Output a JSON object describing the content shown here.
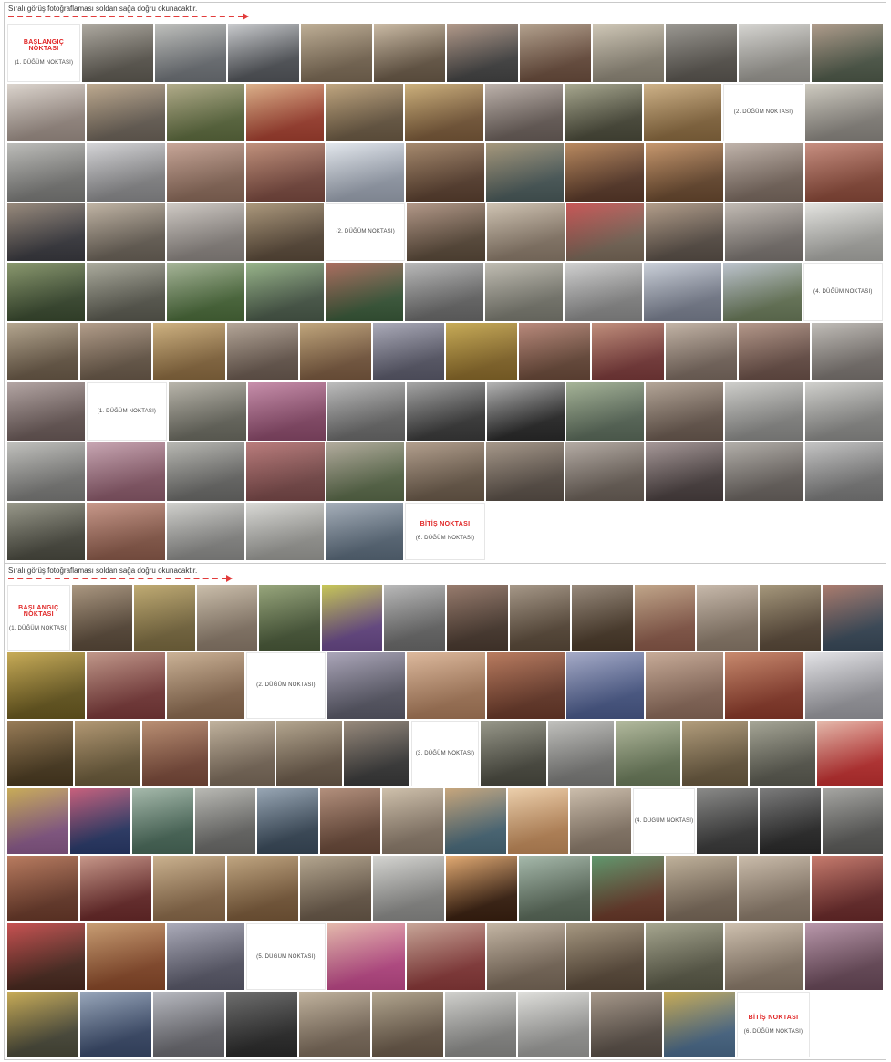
{
  "section1": {
    "heading": "Sıralı görüş fotoğraflaması soldan sağa doğru okunacaktır.",
    "rows": [
      [
        {
          "kind": "label",
          "red": "BAŞLANGIÇ NOKTASI",
          "node": "(1. DÜĞÜM NOKTASI)"
        },
        {
          "kind": "photo",
          "c1": "#5e5a52",
          "c2": "#a39e94"
        },
        {
          "kind": "photo",
          "c1": "#6f7378",
          "c2": "#b7b8b4"
        },
        {
          "kind": "photo",
          "c1": "#53565b",
          "c2": "#c2c4c7"
        },
        {
          "kind": "photo",
          "c1": "#7b6a55",
          "c2": "#b6a488"
        },
        {
          "kind": "photo",
          "c1": "#6a5a48",
          "c2": "#c4b299"
        },
        {
          "kind": "photo",
          "c1": "#444444",
          "c2": "#a88c7a"
        },
        {
          "kind": "photo",
          "c1": "#6b4e3e",
          "c2": "#a9957f"
        },
        {
          "kind": "photo",
          "c1": "#8e8778",
          "c2": "#c9c0ad"
        },
        {
          "kind": "photo",
          "c1": "#5a5650",
          "c2": "#8d8a83"
        },
        {
          "kind": "photo",
          "c1": "#9a9892",
          "c2": "#d0cfcb"
        },
        {
          "kind": "photo",
          "c1": "#4f5a4a",
          "c2": "#a58f7c"
        }
      ],
      [
        {
          "kind": "photo",
          "c1": "#9c8e86",
          "c2": "#d7cfc7"
        },
        {
          "kind": "photo",
          "c1": "#6b6258",
          "c2": "#b59e80"
        },
        {
          "kind": "photo",
          "c1": "#5c6a3e",
          "c2": "#a7a07a"
        },
        {
          "kind": "photo",
          "c1": "#a34030",
          "c2": "#d6a67a"
        },
        {
          "kind": "photo",
          "c1": "#6b5a44",
          "c2": "#b89a6e"
        },
        {
          "kind": "photo",
          "c1": "#7a5a3a",
          "c2": "#c6a66a"
        },
        {
          "kind": "photo",
          "c1": "#6a5f5a",
          "c2": "#b4a8a0"
        },
        {
          "kind": "photo",
          "c1": "#4a4a3a",
          "c2": "#9c9c80"
        },
        {
          "kind": "photo",
          "c1": "#8a6a40",
          "c2": "#c8a878"
        },
        {
          "kind": "label",
          "red": "",
          "node": "(2. DÜĞÜM NOKTASI)"
        },
        {
          "kind": "photo",
          "c1": "#8a8680",
          "c2": "#c8c4b8"
        }
      ],
      [
        {
          "kind": "photo",
          "c1": "#7a7a78",
          "c2": "#b4b4b0"
        },
        {
          "kind": "photo",
          "c1": "#8a8a8c",
          "c2": "#cfcfd2"
        },
        {
          "kind": "photo",
          "c1": "#8a6a5a",
          "c2": "#c09a8a"
        },
        {
          "kind": "photo",
          "c1": "#7a4a40",
          "c2": "#b8826a"
        },
        {
          "kind": "photo",
          "c1": "#9aa2b0",
          "c2": "#dfe4ea"
        },
        {
          "kind": "photo",
          "c1": "#5a4030",
          "c2": "#9a7a5a"
        },
        {
          "kind": "photo",
          "c1": "#4a5a5a",
          "c2": "#9a8a6a"
        },
        {
          "kind": "photo",
          "c1": "#5a3a2a",
          "c2": "#b07a4a"
        },
        {
          "kind": "photo",
          "c1": "#6a4a30",
          "c2": "#c08a5a"
        },
        {
          "kind": "photo",
          "c1": "#7a6a60",
          "c2": "#b8aaa0"
        },
        {
          "kind": "photo",
          "c1": "#8a4a3a",
          "c2": "#c08070"
        }
      ],
      [
        {
          "kind": "photo",
          "c1": "#3a3a40",
          "c2": "#8a7a6a"
        },
        {
          "kind": "photo",
          "c1": "#6a6258",
          "c2": "#b8aa98"
        },
        {
          "kind": "photo",
          "c1": "#8a8480",
          "c2": "#c8c2bc"
        },
        {
          "kind": "photo",
          "c1": "#5a4a3a",
          "c2": "#a08a6a"
        },
        {
          "kind": "label",
          "red": "",
          "node": "(2. DÜĞÜM NOKTASI)"
        },
        {
          "kind": "photo",
          "c1": "#5a4a3a",
          "c2": "#a88a78"
        },
        {
          "kind": "photo",
          "c1": "#8a7a6a",
          "c2": "#c8bba8"
        },
        {
          "kind": "photo",
          "c1": "#7a6a5a",
          "c2": "#c04040"
        },
        {
          "kind": "photo",
          "c1": "#5a5048",
          "c2": "#a8907a"
        },
        {
          "kind": "photo",
          "c1": "#7a7470",
          "c2": "#bab2aa"
        },
        {
          "kind": "photo",
          "c1": "#a8a8a4",
          "c2": "#e0e0dc"
        }
      ],
      [
        {
          "kind": "photo",
          "c1": "#3a4a30",
          "c2": "#7a8a5a"
        },
        {
          "kind": "photo",
          "c1": "#5a5a50",
          "c2": "#a0a090"
        },
        {
          "kind": "photo",
          "c1": "#4a6a3a",
          "c2": "#9aaa8a"
        },
        {
          "kind": "photo",
          "c1": "#4a5a4a",
          "c2": "#8aaa7a"
        },
        {
          "kind": "photo",
          "c1": "#3a5a3a",
          "c2": "#a05a4a"
        },
        {
          "kind": "photo",
          "c1": "#6a6a6a",
          "c2": "#b0b0b0"
        },
        {
          "kind": "photo",
          "c1": "#7a7a70",
          "c2": "#b8b4a8"
        },
        {
          "kind": "photo",
          "c1": "#8a8a8a",
          "c2": "#cacaca"
        },
        {
          "kind": "photo",
          "c1": "#7a8090",
          "c2": "#c4cad4"
        },
        {
          "kind": "photo",
          "c1": "#6a7a5a",
          "c2": "#b4bcc8"
        },
        {
          "kind": "label",
          "red": "",
          "node": "(4. DÜĞÜM NOKTASI)"
        }
      ],
      [
        {
          "kind": "photo",
          "c1": "#6a5a48",
          "c2": "#aa9a80"
        },
        {
          "kind": "photo",
          "c1": "#6a5a4a",
          "c2": "#a8907a"
        },
        {
          "kind": "photo",
          "c1": "#8a6a40",
          "c2": "#c8a870"
        },
        {
          "kind": "photo",
          "c1": "#6a5a50",
          "c2": "#aa9a8a"
        },
        {
          "kind": "photo",
          "c1": "#7a5a40",
          "c2": "#b89a6a"
        },
        {
          "kind": "photo",
          "c1": "#5a5a6a",
          "c2": "#a0a0b0"
        },
        {
          "kind": "photo",
          "c1": "#8a6a2a",
          "c2": "#c0a040"
        },
        {
          "kind": "photo",
          "c1": "#6a4a3a",
          "c2": "#b07a6a"
        },
        {
          "kind": "photo",
          "c1": "#7a3a3a",
          "c2": "#b8806a"
        },
        {
          "kind": "photo",
          "c1": "#7a6a60",
          "c2": "#bbaa9a"
        },
        {
          "kind": "photo",
          "c1": "#6a5048",
          "c2": "#aa8a7a"
        },
        {
          "kind": "photo",
          "c1": "#7a7470",
          "c2": "#b8b4ae"
        }
      ],
      [
        {
          "kind": "photo",
          "c1": "#6a5a58",
          "c2": "#aa9a98"
        },
        {
          "kind": "label",
          "red": "",
          "node": "(1. DÜĞÜM NOKTASI)"
        },
        {
          "kind": "photo",
          "c1": "#6a6a60",
          "c2": "#b0aca0"
        },
        {
          "kind": "photo",
          "c1": "#8a4a6a",
          "c2": "#c080a0"
        },
        {
          "kind": "photo",
          "c1": "#6a6a6a",
          "c2": "#b4b4b4"
        },
        {
          "kind": "photo",
          "c1": "#3a3a3a",
          "c2": "#9a9a9a"
        },
        {
          "kind": "photo",
          "c1": "#2a2a2a",
          "c2": "#aaaaaa"
        },
        {
          "kind": "photo",
          "c1": "#5a6a5a",
          "c2": "#9aaa8a"
        },
        {
          "kind": "photo",
          "c1": "#6a5a50",
          "c2": "#aa9a8a"
        },
        {
          "kind": "photo",
          "c1": "#8a8a88",
          "c2": "#c8c8c4"
        },
        {
          "kind": "photo",
          "c1": "#8a8a88",
          "c2": "#cacac6"
        }
      ],
      [
        {
          "kind": "photo",
          "c1": "#7a7a78",
          "c2": "#b8b8b4"
        },
        {
          "kind": "photo",
          "c1": "#8a5a6a",
          "c2": "#c09aa8"
        },
        {
          "kind": "photo",
          "c1": "#6a6a68",
          "c2": "#aeaea8"
        },
        {
          "kind": "photo",
          "c1": "#7a4a4a",
          "c2": "#b06a6a"
        },
        {
          "kind": "photo",
          "c1": "#5a6a4a",
          "c2": "#a8a090"
        },
        {
          "kind": "photo",
          "c1": "#6a5a4a",
          "c2": "#a8927e"
        },
        {
          "kind": "photo",
          "c1": "#5a5048",
          "c2": "#9a8a7a"
        },
        {
          "kind": "photo",
          "c1": "#6a6058",
          "c2": "#aaa098"
        },
        {
          "kind": "photo",
          "c1": "#4a4040",
          "c2": "#9a8a8a"
        },
        {
          "kind": "photo",
          "c1": "#6a6460",
          "c2": "#a8a49e"
        },
        {
          "kind": "photo",
          "c1": "#7a7a7a",
          "c2": "#bcbcbc"
        }
      ],
      [
        {
          "kind": "photo",
          "c1": "#4a4a40",
          "c2": "#8a8a7a"
        },
        {
          "kind": "photo",
          "c1": "#8a5a4a",
          "c2": "#c08a7a"
        },
        {
          "kind": "photo",
          "c1": "#8a8a88",
          "c2": "#cacac6"
        },
        {
          "kind": "photo",
          "c1": "#9a9a96",
          "c2": "#d4d4d0"
        },
        {
          "kind": "photo",
          "c1": "#5a6a7a",
          "c2": "#9aa4b0"
        },
        {
          "kind": "label",
          "red": "BİTİŞ NOKTASI",
          "node": "(6. DÜĞÜM NOKTASI)"
        },
        {
          "kind": "empty"
        },
        {
          "kind": "empty"
        },
        {
          "kind": "empty"
        },
        {
          "kind": "empty"
        },
        {
          "kind": "empty"
        }
      ]
    ]
  },
  "section2": {
    "heading": "Sıralı görüş fotoğraflaması soldan sağa doğru okunacaktır.",
    "rows": [
      [
        {
          "kind": "label",
          "red": "BAŞLANGIÇ NOKTASI",
          "node": "(1. DÜĞÜM NOKTASI)"
        },
        {
          "kind": "photo",
          "c1": "#5a4a3a",
          "c2": "#a08a70"
        },
        {
          "kind": "photo",
          "c1": "#7a6a40",
          "c2": "#b8a060"
        },
        {
          "kind": "photo",
          "c1": "#8a7a6a",
          "c2": "#c4b6a0"
        },
        {
          "kind": "photo",
          "c1": "#4a5a3a",
          "c2": "#8a9a6a"
        },
        {
          "kind": "photo",
          "c1": "#6a4a8a",
          "c2": "#c0c040"
        },
        {
          "kind": "photo",
          "c1": "#6a6a6a",
          "c2": "#b0b0b0"
        },
        {
          "kind": "photo",
          "c1": "#4a3a30",
          "c2": "#8a6a5a"
        },
        {
          "kind": "photo",
          "c1": "#5a4a3a",
          "c2": "#9a8a78"
        },
        {
          "kind": "photo",
          "c1": "#4a3a2a",
          "c2": "#8a7a6a"
        },
        {
          "kind": "photo",
          "c1": "#8a5a4a",
          "c2": "#b89a7a"
        },
        {
          "kind": "photo",
          "c1": "#8a7a6a",
          "c2": "#c0b0a0"
        },
        {
          "kind": "photo",
          "c1": "#5a4a3a",
          "c2": "#9a8a6a"
        },
        {
          "kind": "photo",
          "c1": "#3a4a5a",
          "c2": "#a06a5a"
        }
      ],
      [
        {
          "kind": "photo",
          "c1": "#6a5a20",
          "c2": "#c0a040"
        },
        {
          "kind": "photo",
          "c1": "#7a3a3a",
          "c2": "#b88a7a"
        },
        {
          "kind": "photo",
          "c1": "#8a6a50",
          "c2": "#c4a888"
        },
        {
          "kind": "label",
          "red": "",
          "node": "(2. DÜĞÜM NOKTASI)"
        },
        {
          "kind": "photo",
          "c1": "#5a5a68",
          "c2": "#a09ab0"
        },
        {
          "kind": "photo",
          "c1": "#a87a5a",
          "c2": "#d8b090"
        },
        {
          "kind": "photo",
          "c1": "#6a3a2a",
          "c2": "#b06a4a"
        },
        {
          "kind": "photo",
          "c1": "#4a5a8a",
          "c2": "#9aa0c0"
        },
        {
          "kind": "photo",
          "c1": "#8a6a5a",
          "c2": "#c0a08a"
        },
        {
          "kind": "photo",
          "c1": "#8a3a2a",
          "c2": "#c07a5a"
        },
        {
          "kind": "photo",
          "c1": "#9a9aa0",
          "c2": "#e0e0e4"
        }
      ],
      [
        {
          "kind": "photo",
          "c1": "#4a3a20",
          "c2": "#8a6a40"
        },
        {
          "kind": "photo",
          "c1": "#6a5a3a",
          "c2": "#a88a60"
        },
        {
          "kind": "photo",
          "c1": "#7a4a3a",
          "c2": "#b08060"
        },
        {
          "kind": "photo",
          "c1": "#7a6a5a",
          "c2": "#b8a890"
        },
        {
          "kind": "photo",
          "c1": "#6a5a4a",
          "c2": "#aa9a80"
        },
        {
          "kind": "photo",
          "c1": "#3a3a3a",
          "c2": "#8a7a6a"
        },
        {
          "kind": "label",
          "red": "",
          "node": "(3. DÜĞÜM NOKTASI)"
        },
        {
          "kind": "photo",
          "c1": "#4a4a40",
          "c2": "#8a8a7a"
        },
        {
          "kind": "photo",
          "c1": "#7a7a78",
          "c2": "#b8b8b4"
        },
        {
          "kind": "photo",
          "c1": "#6a7a5a",
          "c2": "#a8b090"
        },
        {
          "kind": "photo",
          "c1": "#6a5a40",
          "c2": "#a8906a"
        },
        {
          "kind": "photo",
          "c1": "#5a5a50",
          "c2": "#9a9a88"
        },
        {
          "kind": "photo",
          "c1": "#c03030",
          "c2": "#e0b0a0"
        }
      ],
      [
        {
          "kind": "photo",
          "c1": "#8a5a8a",
          "c2": "#c0a040"
        },
        {
          "kind": "photo",
          "c1": "#2a3a6a",
          "c2": "#c04a6a"
        },
        {
          "kind": "photo",
          "c1": "#4a6a5a",
          "c2": "#9ab0a0"
        },
        {
          "kind": "photo",
          "c1": "#6a6a68",
          "c2": "#b0b0aa"
        },
        {
          "kind": "photo",
          "c1": "#3a4a5a",
          "c2": "#8a9aaa"
        },
        {
          "kind": "photo",
          "c1": "#6a4a3a",
          "c2": "#a8806a"
        },
        {
          "kind": "photo",
          "c1": "#8a7a6a",
          "c2": "#c8b8a0"
        },
        {
          "kind": "photo",
          "c1": "#4a6a7a",
          "c2": "#c09a6a"
        },
        {
          "kind": "photo",
          "c1": "#c08a5a",
          "c2": "#e8c8a0"
        },
        {
          "kind": "photo",
          "c1": "#8a7a6a",
          "c2": "#c4b4a0"
        },
        {
          "kind": "label",
          "red": "",
          "node": "(4. DÜĞÜM NOKTASI)"
        },
        {
          "kind": "photo",
          "c1": "#3a3a3a",
          "c2": "#7a7a78"
        },
        {
          "kind": "photo",
          "c1": "#2a2a2a",
          "c2": "#6a6a6a"
        },
        {
          "kind": "photo",
          "c1": "#5a5a58",
          "c2": "#9a9a96"
        }
      ],
      [
        {
          "kind": "photo",
          "c1": "#6a3a2a",
          "c2": "#b06a4a"
        },
        {
          "kind": "photo",
          "c1": "#6a2a2a",
          "c2": "#c08a7a"
        },
        {
          "kind": "photo",
          "c1": "#8a6a4a",
          "c2": "#c4a880"
        },
        {
          "kind": "photo",
          "c1": "#7a5a3a",
          "c2": "#b89a70"
        },
        {
          "kind": "photo",
          "c1": "#6a5a4a",
          "c2": "#aa9a80"
        },
        {
          "kind": "photo",
          "c1": "#8a8a88",
          "c2": "#d0d0cc"
        },
        {
          "kind": "photo",
          "c1": "#3a2010",
          "c2": "#e0a060"
        },
        {
          "kind": "photo",
          "c1": "#5a6a5a",
          "c2": "#9ab0a0"
        },
        {
          "kind": "photo",
          "c1": "#6a3a2a",
          "c2": "#4a8a5a"
        },
        {
          "kind": "photo",
          "c1": "#7a6a5a",
          "c2": "#b8a88e"
        },
        {
          "kind": "photo",
          "c1": "#8a7a6a",
          "c2": "#c4b4a0"
        },
        {
          "kind": "photo",
          "c1": "#6a2a2a",
          "c2": "#c06a5a"
        }
      ],
      [
        {
          "kind": "photo",
          "c1": "#4a2a20",
          "c2": "#c03a3a"
        },
        {
          "kind": "photo",
          "c1": "#8a4a2a",
          "c2": "#c09060"
        },
        {
          "kind": "photo",
          "c1": "#5a5a6a",
          "c2": "#a0a0b0"
        },
        {
          "kind": "label",
          "red": "",
          "node": "(5. DÜĞÜM NOKTASI)"
        },
        {
          "kind": "photo",
          "c1": "#c04a8a",
          "c2": "#e0b0a0"
        },
        {
          "kind": "photo",
          "c1": "#8a3a3a",
          "c2": "#c09a8a"
        },
        {
          "kind": "photo",
          "c1": "#7a6a5a",
          "c2": "#bcac98"
        },
        {
          "kind": "photo",
          "c1": "#5a4a3a",
          "c2": "#9a8a70"
        },
        {
          "kind": "photo",
          "c1": "#5a5a48",
          "c2": "#9a9a80"
        },
        {
          "kind": "photo",
          "c1": "#8a7a6a",
          "c2": "#c8b8a4"
        },
        {
          "kind": "photo",
          "c1": "#6a4a5a",
          "c2": "#b08aa0"
        }
      ],
      [
        {
          "kind": "photo",
          "c1": "#4a4a3a",
          "c2": "#c0a040"
        },
        {
          "kind": "photo",
          "c1": "#3a4a6a",
          "c2": "#8a9ab0"
        },
        {
          "kind": "photo",
          "c1": "#6a6a70",
          "c2": "#aeb0b8"
        },
        {
          "kind": "photo",
          "c1": "#2a2a2a",
          "c2": "#5a5a5a"
        },
        {
          "kind": "photo",
          "c1": "#7a6a5a",
          "c2": "#b8a890"
        },
        {
          "kind": "photo",
          "c1": "#6a5a4a",
          "c2": "#a89a80"
        },
        {
          "kind": "photo",
          "c1": "#8a8a88",
          "c2": "#cacac6"
        },
        {
          "kind": "photo",
          "c1": "#9a9a98",
          "c2": "#dadad6"
        },
        {
          "kind": "photo",
          "c1": "#5a5048",
          "c2": "#9a8a7a"
        },
        {
          "kind": "photo",
          "c1": "#4a6a8a",
          "c2": "#c0a040"
        },
        {
          "kind": "label",
          "red": "BİTİŞ NOKTASI",
          "node": "(6. DÜĞÜM NOKTASI)"
        },
        {
          "kind": "empty"
        }
      ]
    ]
  }
}
